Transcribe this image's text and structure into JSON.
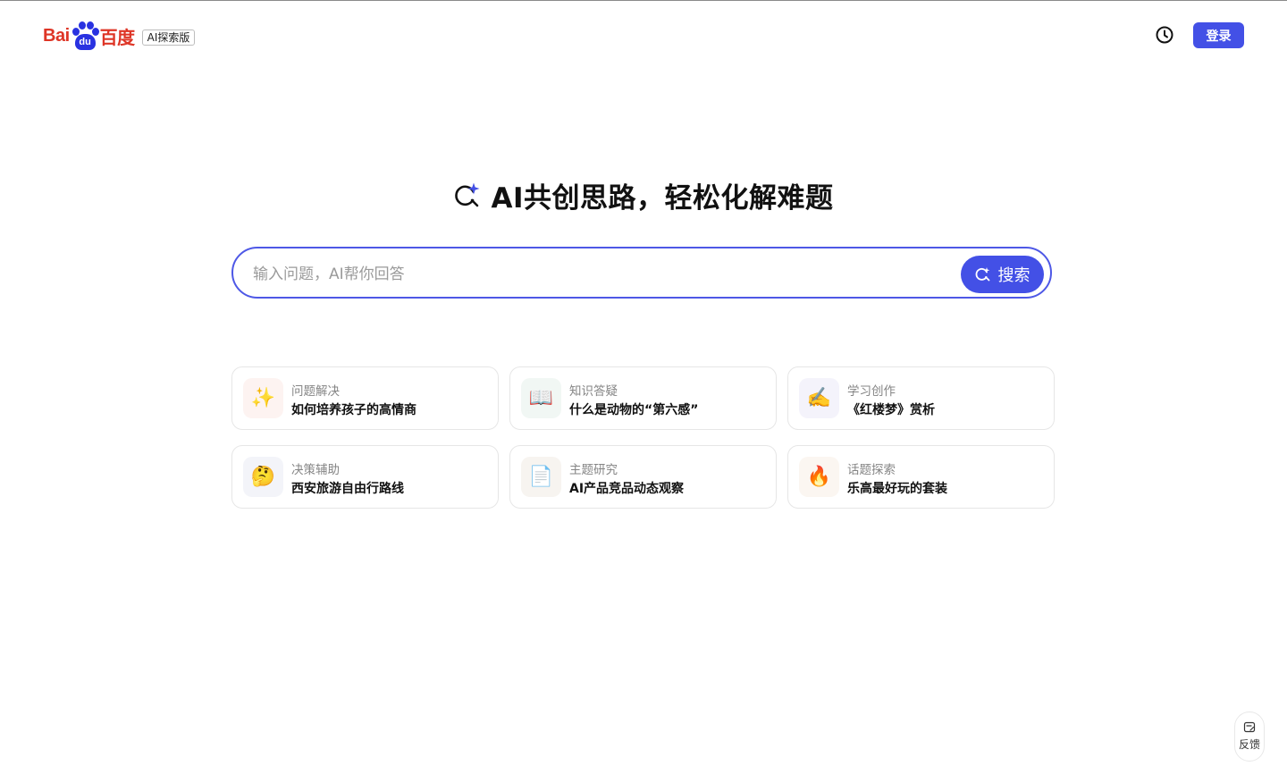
{
  "header": {
    "logo": {
      "text_left": "Bai",
      "paw_text": "du",
      "text_right": "百度",
      "badge": "AI探索版"
    },
    "history_icon": "clock-icon",
    "login_label": "登录"
  },
  "hero": {
    "icon": "ai-search-sparkle-icon",
    "title": "AI共创思路，轻松化解难题"
  },
  "search": {
    "placeholder": "输入问题，AI帮你回答",
    "button_label": "搜索",
    "button_icon": "ai-search-icon"
  },
  "suggestions": [
    {
      "icon": "sparkles-icon",
      "emoji": "✨",
      "bg": "#fdf3f1",
      "category": "问题解决",
      "question": "如何培养孩子的高情商"
    },
    {
      "icon": "open-book-icon",
      "emoji": "📖",
      "bg": "#f1f7f4",
      "category": "知识答疑",
      "question": "什么是动物的“第六感”"
    },
    {
      "icon": "writing-hand-icon",
      "emoji": "✍️",
      "bg": "#f4f3fb",
      "category": "学习创作",
      "question": "《红楼梦》赏析"
    },
    {
      "icon": "thinking-face-icon",
      "emoji": "🤔",
      "bg": "#f3f4f9",
      "category": "决策辅助",
      "question": "西安旅游自由行路线"
    },
    {
      "icon": "document-icon",
      "emoji": "📄",
      "bg": "#f7f4f0",
      "category": "主题研究",
      "question": "AI产品竞品动态观察"
    },
    {
      "icon": "fire-icon",
      "emoji": "🔥",
      "bg": "#fbf6f1",
      "category": "话题探索",
      "question": "乐高最好玩的套装"
    }
  ],
  "feedback": {
    "icon": "feedback-edit-icon",
    "label": "反馈"
  },
  "colors": {
    "accent": "#4350e6",
    "logo_red": "#de3526",
    "logo_blue": "#2932e1"
  }
}
